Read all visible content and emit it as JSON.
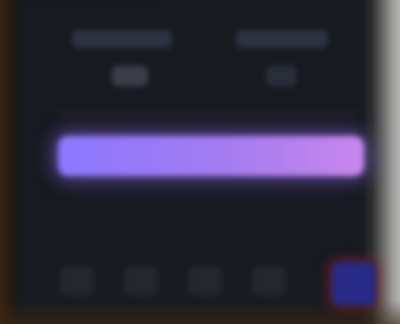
{
  "colors": {
    "panel": "#171a21",
    "accent_start": "#8c78ff",
    "accent_end": "#c887ec",
    "active_tab": "#272a86"
  },
  "primary_action": {
    "label": ""
  },
  "bottom_bar": {
    "active_index": 4
  }
}
